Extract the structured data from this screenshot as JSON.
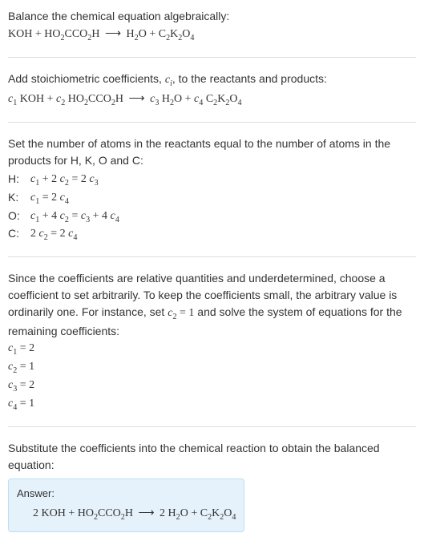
{
  "s1": {
    "instruction": "Balance the chemical equation algebraically:",
    "eq_lhs1a": "KOH + HO",
    "eq_lhs1b": "CCO",
    "eq_lhs1c": "H",
    "arrow": "⟶",
    "eq_rhs1a": "H",
    "eq_rhs1b": "O + C",
    "eq_rhs1c": "K",
    "eq_rhs1d": "O"
  },
  "s2": {
    "t1": "Add stoichiometric coefficients, ",
    "civar": "c",
    "isub": "i",
    "t2": ", to the reactants and products:",
    "c1": "c",
    "c2": "c",
    "c3": "c",
    "c4": "c",
    "koh": " KOH + ",
    "ho": " HO",
    "cco": "CCO",
    "h": "H",
    "arrow": "⟶",
    "h2o": " H",
    "oplus": "O + ",
    "ck": " C",
    "k": "K",
    "o": "O"
  },
  "s3": {
    "text": "Set the number of atoms in the reactants equal to the number of atoms in the products for H, K, O and C:",
    "rows": [
      {
        "el": "H:",
        "c1": "c",
        "s1": "1",
        "plus": " + 2 ",
        "c2": "c",
        "s2": "2",
        "eq": " = 2 ",
        "c3": "c",
        "s3": "3"
      },
      {
        "el": "K:",
        "c1": "c",
        "s1": "1",
        "eq": " = 2 ",
        "c4": "c",
        "s4": "4"
      },
      {
        "el": "O:",
        "c1": "c",
        "s1": "1",
        "plus": " + 4 ",
        "c2": "c",
        "s2": "2",
        "eq": " = ",
        "c3": "c",
        "s3": "3",
        "plus2": " + 4 ",
        "c4": "c",
        "s4": "4"
      },
      {
        "el": "C:",
        "pre": "2 ",
        "c2": "c",
        "s2": "2",
        "eq": " = 2 ",
        "c4": "c",
        "s4": "4"
      }
    ]
  },
  "s4": {
    "t1": "Since the coefficients are relative quantities and underdetermined, choose a coefficient to set arbitrarily. To keep the coefficients small, the arbitrary value is ordinarily one. For instance, set ",
    "cv": "c",
    "cs": "2",
    "cval": " = 1",
    "t2": " and solve the system of equations for the remaining coefficients:",
    "lines": [
      {
        "v": "c",
        "s": "1",
        "r": " = 2"
      },
      {
        "v": "c",
        "s": "2",
        "r": " = 1"
      },
      {
        "v": "c",
        "s": "3",
        "r": " = 2"
      },
      {
        "v": "c",
        "s": "4",
        "r": " = 1"
      }
    ]
  },
  "s5": {
    "text": "Substitute the coefficients into the chemical reaction to obtain the balanced equation:",
    "answer_label": "Answer:",
    "eq_a": "2 KOH + HO",
    "eq_b": "CCO",
    "eq_c": "H",
    "arrow": "⟶",
    "eq_d": "2 H",
    "eq_e": "O + C",
    "eq_f": "K",
    "eq_g": "O"
  },
  "subs": {
    "n2": "2",
    "n4": "4",
    "n1": "1",
    "n3": "3"
  }
}
